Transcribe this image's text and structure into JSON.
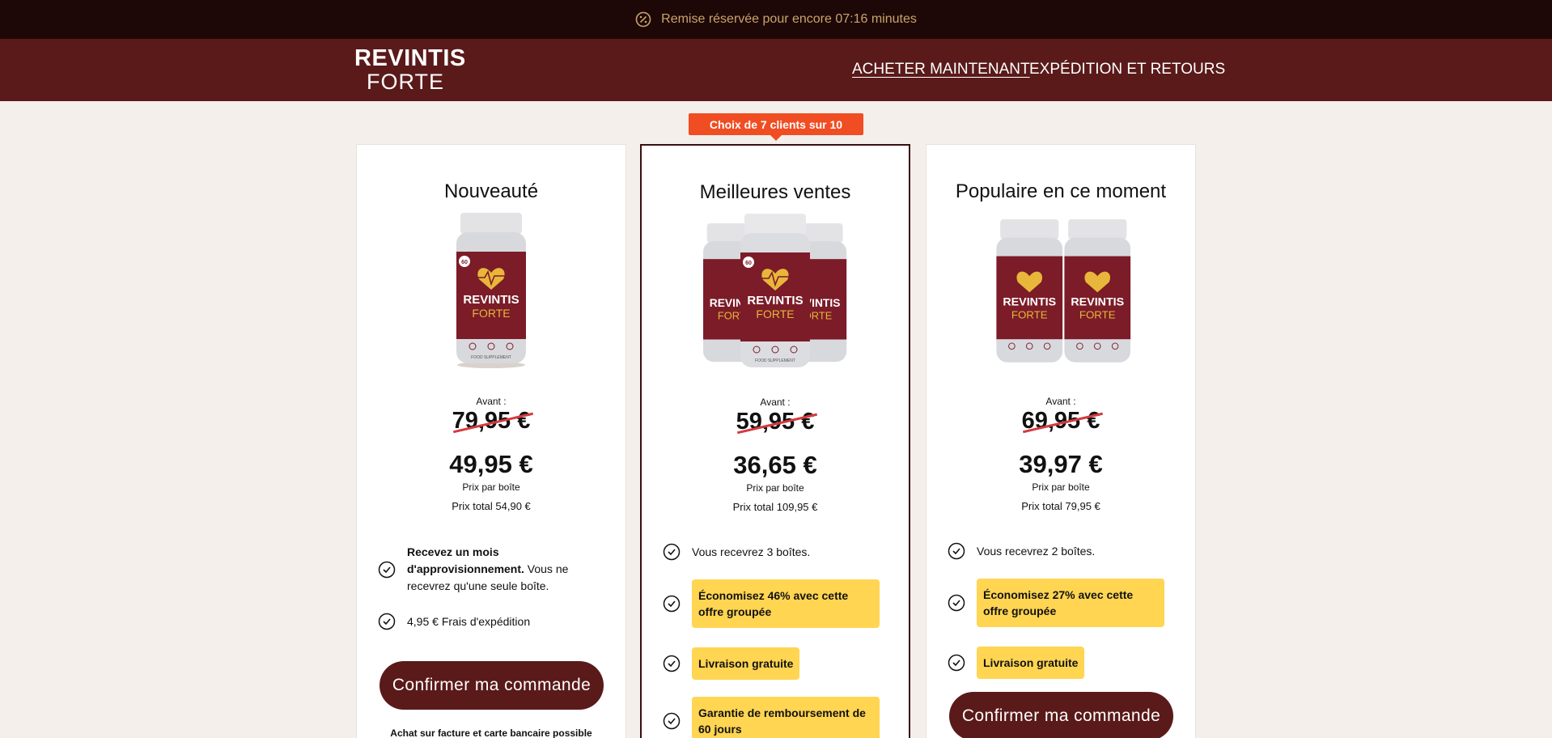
{
  "topbar": {
    "text": "Remise réservée pour encore 07:16 minutes"
  },
  "header": {
    "logo_line1": "REVINTIS",
    "logo_line2": "FORTE",
    "nav": [
      "ACHETER MAINTENANT",
      "EXPÉDITION ET RETOURS"
    ]
  },
  "badge": "Choix de 7 clients sur 10",
  "bottle": {
    "brand": "REVINTIS",
    "variant": "FORTE",
    "count": "60",
    "supplement": "FOOD SUPPLEMENT"
  },
  "colors": {
    "topbar": "#1e0807",
    "header": "#5a1a1a",
    "accent_badge": "#f04d23",
    "highlight": "#ffd552",
    "strike": "#d43a3f"
  },
  "cards": [
    {
      "title": "Nouveauté",
      "before_label": "Avant :",
      "old_price": "79,95 €",
      "new_price": "49,95 €",
      "per_box": "Prix par boîte",
      "total": "Prix total 54,90 €",
      "feature1_bold": "Recevez un mois d'approvisionnement.",
      "feature1_rest": " Vous ne recevrez qu'une seule boîte.",
      "feature2": "4,95 € Frais d'expédition",
      "button": "Confirmer ma commande",
      "payment_note": "Achat sur facture et carte bancaire possible"
    },
    {
      "title": "Meilleures ventes",
      "before_label": "Avant :",
      "old_price": "59,95 €",
      "new_price": "36,65 €",
      "per_box": "Prix par boîte",
      "total": "Prix total 109,95 €",
      "feature1": "Vous recevrez 3 boîtes.",
      "highlight1": "Économisez 46% avec cette offre groupée",
      "highlight2": "Livraison gratuite",
      "highlight3": "Garantie de remboursement de 60 jours"
    },
    {
      "title": "Populaire en ce moment",
      "before_label": "Avant :",
      "old_price": "69,95 €",
      "new_price": "39,97 €",
      "per_box": "Prix par boîte",
      "total": "Prix total 79,95 €",
      "feature1": "Vous recevrez 2 boîtes.",
      "highlight1": "Économisez 27% avec cette offre groupée",
      "highlight2": "Livraison gratuite",
      "button": "Confirmer ma commande"
    }
  ]
}
